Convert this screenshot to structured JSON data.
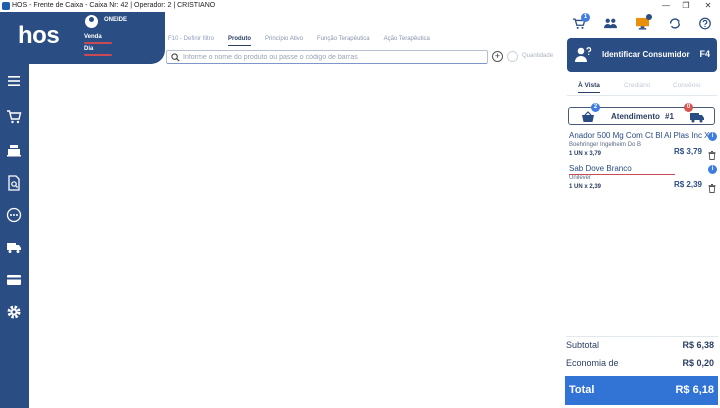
{
  "window": {
    "title": "HOS - Frente de Caixa - Caixa Nr: 42 | Operador: 2 | CRISTIANO",
    "minimize": "—",
    "maximize": "❐",
    "close": "✕"
  },
  "header": {
    "logo": "hos",
    "user": "ONEIDE",
    "stat_venda": "Venda",
    "stat_dia": "Dia"
  },
  "top_icons": {
    "cart_badge": "1",
    "notif_badge": "1"
  },
  "filters": {
    "tabs": [
      "F10 - Definir filtro",
      "Produto",
      "Princípio Ativo",
      "Função Terapêutica",
      "Ação Terapêutica"
    ],
    "active_index": 1
  },
  "search": {
    "placeholder": "Informe o nome do produto ou passe o código de barras",
    "add_label": "+",
    "qty_placeholder": "Quantidade"
  },
  "consumer": {
    "label": "Identificar Consumidor",
    "shortcut": "F4"
  },
  "payment_tabs": [
    "À Vista",
    "Crediário",
    "Convênio"
  ],
  "atendimento": {
    "label": "Atendimento",
    "number": "#1",
    "basket_badge": "2",
    "delivery_badge": "0"
  },
  "items": [
    {
      "name": "Anador 500 Mg Com Ct Bl Al Plas Inc X",
      "manufacturer": "Boehringer Ingelheim Do B",
      "qty": "1 UN x 3,79",
      "price": "R$ 3,79",
      "info": "i"
    },
    {
      "name": "Sab Dove Branco",
      "manufacturer": "Unilever",
      "qty": "1 UN x 2,39",
      "price": "R$ 2,39",
      "info": "i"
    }
  ],
  "summary": {
    "subtotal_label": "Subtotal",
    "subtotal": "R$ 6,38",
    "economia_label": "Economia de",
    "economia": "R$ 0,20",
    "total_label": "Total",
    "total": "R$ 6,18"
  },
  "colors": {
    "brand": "#2a4d84",
    "accent": "#3273d6",
    "alert": "#c94a55"
  }
}
